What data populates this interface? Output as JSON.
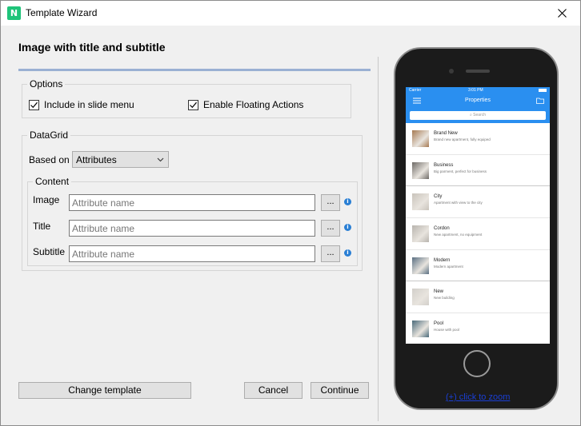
{
  "window": {
    "title": "Template Wizard",
    "app_icon_letter": "N"
  },
  "heading": "Image with title and subtitle",
  "options": {
    "legend": "Options",
    "include_slide_menu": {
      "label": "Include in slide menu",
      "checked": true
    },
    "floating_actions": {
      "label": "Enable Floating Actions",
      "checked": true
    }
  },
  "datagrid": {
    "legend": "DataGrid",
    "based_on_label": "Based on",
    "based_on_value": "Attributes",
    "content": {
      "legend": "Content",
      "fields": [
        {
          "label": "Image",
          "placeholder": "Attribute name",
          "button": "..."
        },
        {
          "label": "Title",
          "placeholder": "Attribute name",
          "button": "..."
        },
        {
          "label": "Subtitle",
          "placeholder": "Attribute name",
          "button": "..."
        }
      ]
    }
  },
  "buttons": {
    "change_template": "Change template",
    "cancel": "Cancel",
    "continue": "Continue"
  },
  "preview": {
    "status_carrier": "Carrier",
    "status_time": "3:01 PM",
    "app_title": "Properties",
    "search_placeholder": "Search",
    "items": [
      {
        "title": "Brand New",
        "subtitle": "Brand new apartment, fully equiped",
        "color": "#a67a52"
      },
      {
        "title": "Business",
        "subtitle": "Big parment, perfect for business",
        "color": "#6e6a66"
      },
      {
        "title": "City",
        "subtitle": "Apartment with view to the city",
        "color": "#c9c3bb"
      },
      {
        "title": "Cordon",
        "subtitle": "New apartment, no equipment",
        "color": "#b8b4ae"
      },
      {
        "title": "Modern",
        "subtitle": "Modern apartment",
        "color": "#5a6f82"
      },
      {
        "title": "New",
        "subtitle": "New building",
        "color": "#d2cfca"
      },
      {
        "title": "Pool",
        "subtitle": "House with pool",
        "color": "#4a6a7a"
      }
    ],
    "zoom_link": "(+) click to zoom"
  },
  "colors": {
    "accent": "#2a8ff0",
    "heading_line": "#9ab0d3",
    "info": "#2a7fd4",
    "link": "#1a3fd6"
  }
}
